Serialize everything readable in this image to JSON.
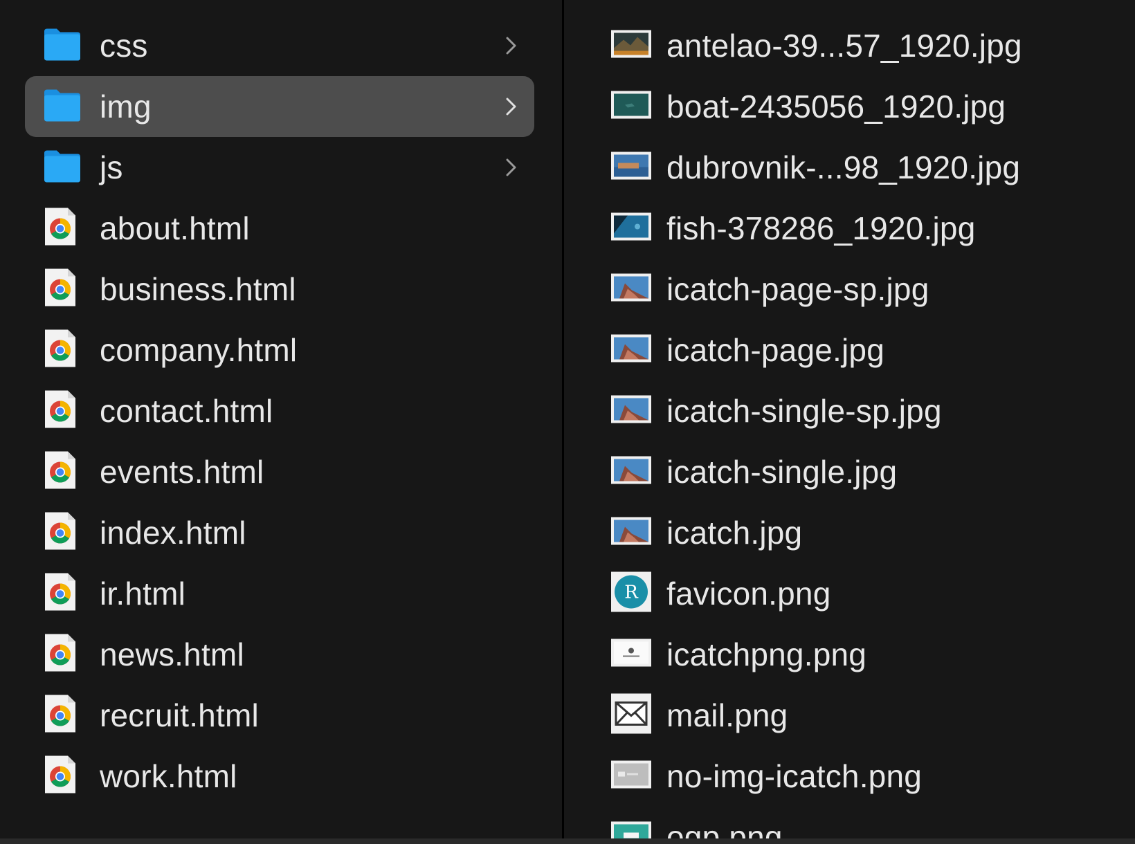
{
  "left_column": {
    "items": [
      {
        "label": "css",
        "kind": "folder",
        "icon": "folder-icon",
        "has_children": true,
        "selected": false
      },
      {
        "label": "img",
        "kind": "folder",
        "icon": "folder-icon",
        "has_children": true,
        "selected": true
      },
      {
        "label": "js",
        "kind": "folder",
        "icon": "folder-icon",
        "has_children": true,
        "selected": false
      },
      {
        "label": "about.html",
        "kind": "file",
        "icon": "chrome-html-file-icon",
        "has_children": false,
        "selected": false
      },
      {
        "label": "business.html",
        "kind": "file",
        "icon": "chrome-html-file-icon",
        "has_children": false,
        "selected": false
      },
      {
        "label": "company.html",
        "kind": "file",
        "icon": "chrome-html-file-icon",
        "has_children": false,
        "selected": false
      },
      {
        "label": "contact.html",
        "kind": "file",
        "icon": "chrome-html-file-icon",
        "has_children": false,
        "selected": false
      },
      {
        "label": "events.html",
        "kind": "file",
        "icon": "chrome-html-file-icon",
        "has_children": false,
        "selected": false
      },
      {
        "label": "index.html",
        "kind": "file",
        "icon": "chrome-html-file-icon",
        "has_children": false,
        "selected": false
      },
      {
        "label": "ir.html",
        "kind": "file",
        "icon": "chrome-html-file-icon",
        "has_children": false,
        "selected": false
      },
      {
        "label": "news.html",
        "kind": "file",
        "icon": "chrome-html-file-icon",
        "has_children": false,
        "selected": false
      },
      {
        "label": "recruit.html",
        "kind": "file",
        "icon": "chrome-html-file-icon",
        "has_children": false,
        "selected": false
      },
      {
        "label": "work.html",
        "kind": "file",
        "icon": "chrome-html-file-icon",
        "has_children": false,
        "selected": false
      }
    ]
  },
  "right_column": {
    "items": [
      {
        "label": "antelao-39...57_1920.jpg",
        "thumb": "landscape-photo-thumbnail"
      },
      {
        "label": "boat-2435056_1920.jpg",
        "thumb": "sea-photo-thumbnail"
      },
      {
        "label": "dubrovnik-...98_1920.jpg",
        "thumb": "town-photo-thumbnail"
      },
      {
        "label": "fish-378286_1920.jpg",
        "thumb": "underwater-photo-thumbnail"
      },
      {
        "label": "icatch-page-sp.jpg",
        "thumb": "seal-photo-thumbnail"
      },
      {
        "label": "icatch-page.jpg",
        "thumb": "seal-photo-thumbnail"
      },
      {
        "label": "icatch-single-sp.jpg",
        "thumb": "seal-photo-thumbnail"
      },
      {
        "label": "icatch-single.jpg",
        "thumb": "seal-photo-thumbnail"
      },
      {
        "label": "icatch.jpg",
        "thumb": "seal-photo-thumbnail"
      },
      {
        "label": "favicon.png",
        "thumb": "favicon-r-thumbnail",
        "glyph": "R"
      },
      {
        "label": "icatchpng.png",
        "thumb": "wordpress-logo-thumbnail"
      },
      {
        "label": "mail.png",
        "thumb": "envelope-thumbnail"
      },
      {
        "label": "no-img-icatch.png",
        "thumb": "no-image-thumbnail"
      },
      {
        "label": "ogp.png",
        "thumb": "ogp-thumbnail"
      }
    ]
  },
  "colors": {
    "background": "#171717",
    "selection": "#4d4d4d",
    "text": "#e8e8e8",
    "folder": "#1fa3f0",
    "favicon": "#1a8fa8"
  }
}
